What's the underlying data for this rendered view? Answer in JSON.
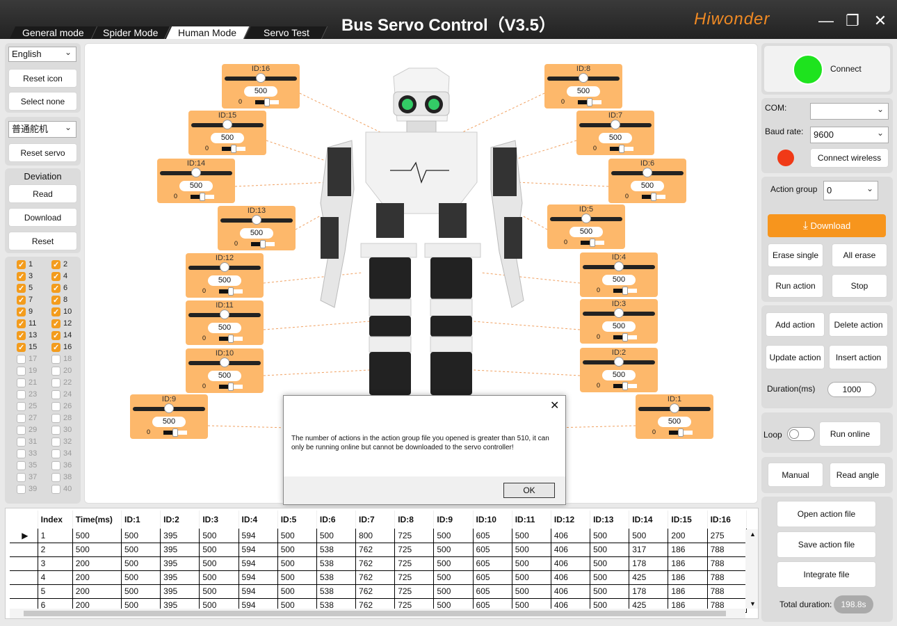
{
  "window": {
    "title": "Bus Servo Control（V3.5）",
    "brand": "Hiwonder"
  },
  "tabs": [
    {
      "label": "General mode"
    },
    {
      "label": "Spider Mode"
    },
    {
      "label": "Human Mode"
    },
    {
      "label": "Servo Test"
    }
  ],
  "left": {
    "language": "English",
    "reset_icon": "Reset icon",
    "select_none": "Select none",
    "servo_type": "普通舵机",
    "reset_servo": "Reset servo",
    "deviation": "Deviation",
    "read": "Read",
    "download": "Download",
    "reset": "Reset",
    "checkboxes": [
      {
        "n": "1",
        "on": true
      },
      {
        "n": "2",
        "on": true
      },
      {
        "n": "3",
        "on": true
      },
      {
        "n": "4",
        "on": true
      },
      {
        "n": "5",
        "on": true
      },
      {
        "n": "6",
        "on": true
      },
      {
        "n": "7",
        "on": true
      },
      {
        "n": "8",
        "on": true
      },
      {
        "n": "9",
        "on": true
      },
      {
        "n": "10",
        "on": true
      },
      {
        "n": "11",
        "on": true
      },
      {
        "n": "12",
        "on": true
      },
      {
        "n": "13",
        "on": true
      },
      {
        "n": "14",
        "on": true
      },
      {
        "n": "15",
        "on": true
      },
      {
        "n": "16",
        "on": true
      },
      {
        "n": "17",
        "on": false
      },
      {
        "n": "18",
        "on": false
      },
      {
        "n": "19",
        "on": false
      },
      {
        "n": "20",
        "on": false
      },
      {
        "n": "21",
        "on": false
      },
      {
        "n": "22",
        "on": false
      },
      {
        "n": "23",
        "on": false
      },
      {
        "n": "24",
        "on": false
      },
      {
        "n": "25",
        "on": false
      },
      {
        "n": "26",
        "on": false
      },
      {
        "n": "27",
        "on": false
      },
      {
        "n": "28",
        "on": false
      },
      {
        "n": "29",
        "on": false
      },
      {
        "n": "30",
        "on": false
      },
      {
        "n": "31",
        "on": false
      },
      {
        "n": "32",
        "on": false
      },
      {
        "n": "33",
        "on": false
      },
      {
        "n": "34",
        "on": false
      },
      {
        "n": "35",
        "on": false
      },
      {
        "n": "36",
        "on": false
      },
      {
        "n": "37",
        "on": false
      },
      {
        "n": "38",
        "on": false
      },
      {
        "n": "39",
        "on": false
      },
      {
        "n": "40",
        "on": false
      }
    ]
  },
  "servos": [
    {
      "id": "ID:16",
      "value": "500",
      "zero": "0"
    },
    {
      "id": "ID:15",
      "value": "500",
      "zero": "0"
    },
    {
      "id": "ID:14",
      "value": "500",
      "zero": "0"
    },
    {
      "id": "ID:13",
      "value": "500",
      "zero": "0"
    },
    {
      "id": "ID:12",
      "value": "500",
      "zero": "0"
    },
    {
      "id": "ID:11",
      "value": "500",
      "zero": "0"
    },
    {
      "id": "ID:10",
      "value": "500",
      "zero": "0"
    },
    {
      "id": "ID:9",
      "value": "500",
      "zero": "0"
    },
    {
      "id": "ID:8",
      "value": "500",
      "zero": "0"
    },
    {
      "id": "ID:7",
      "value": "500",
      "zero": "0"
    },
    {
      "id": "ID:6",
      "value": "500",
      "zero": "0"
    },
    {
      "id": "ID:5",
      "value": "500",
      "zero": "0"
    },
    {
      "id": "ID:4",
      "value": "500",
      "zero": "0"
    },
    {
      "id": "ID:3",
      "value": "500",
      "zero": "0"
    },
    {
      "id": "ID:2",
      "value": "500",
      "zero": "0"
    },
    {
      "id": "ID:1",
      "value": "500",
      "zero": "0"
    }
  ],
  "dialog": {
    "message": "The number of actions in the action group file you opened is greater than 510, it can only be running online but cannot be downloaded to the servo controller!",
    "ok": "OK"
  },
  "right": {
    "connect": "Connect",
    "connect_status_color": "#1ee31e",
    "com_label": "COM:",
    "com_value": "",
    "baud_label": "Baud rate:",
    "baud_value": "9600",
    "wireless_status_color": "#f03a17",
    "connect_wireless": "Connect wireless",
    "action_group_label": "Action group",
    "action_group_value": "0",
    "download": "Download",
    "erase_single": "Erase single",
    "all_erase": "All erase",
    "run_action": "Run action",
    "stop": "Stop",
    "add_action": "Add action",
    "delete_action": "Delete action",
    "update_action": "Update action",
    "insert_action": "Insert action",
    "duration_label": "Duration(ms)",
    "duration_value": "1000",
    "loop": "Loop",
    "run_online": "Run online",
    "manual": "Manual",
    "read_angle": "Read angle",
    "open_file": "Open action file",
    "save_file": "Save action file",
    "integrate": "Integrate file",
    "total_label": "Total duration:",
    "total_value": "198.8s"
  },
  "table": {
    "headers": [
      "Index",
      "Time(ms)",
      "ID:1",
      "ID:2",
      "ID:3",
      "ID:4",
      "ID:5",
      "ID:6",
      "ID:7",
      "ID:8",
      "ID:9",
      "ID:10",
      "ID:11",
      "ID:12",
      "ID:13",
      "ID:14",
      "ID:15",
      "ID:16"
    ],
    "rows": [
      [
        "1",
        "500",
        "500",
        "395",
        "500",
        "594",
        "500",
        "500",
        "800",
        "725",
        "500",
        "605",
        "500",
        "406",
        "500",
        "500",
        "200",
        "275"
      ],
      [
        "2",
        "500",
        "500",
        "395",
        "500",
        "594",
        "500",
        "538",
        "762",
        "725",
        "500",
        "605",
        "500",
        "406",
        "500",
        "317",
        "186",
        "788"
      ],
      [
        "3",
        "200",
        "500",
        "395",
        "500",
        "594",
        "500",
        "538",
        "762",
        "725",
        "500",
        "605",
        "500",
        "406",
        "500",
        "178",
        "186",
        "788"
      ],
      [
        "4",
        "200",
        "500",
        "395",
        "500",
        "594",
        "500",
        "538",
        "762",
        "725",
        "500",
        "605",
        "500",
        "406",
        "500",
        "425",
        "186",
        "788"
      ],
      [
        "5",
        "200",
        "500",
        "395",
        "500",
        "594",
        "500",
        "538",
        "762",
        "725",
        "500",
        "605",
        "500",
        "406",
        "500",
        "178",
        "186",
        "788"
      ],
      [
        "6",
        "200",
        "500",
        "395",
        "500",
        "594",
        "500",
        "538",
        "762",
        "725",
        "500",
        "605",
        "500",
        "406",
        "500",
        "425",
        "186",
        "788"
      ]
    ]
  }
}
